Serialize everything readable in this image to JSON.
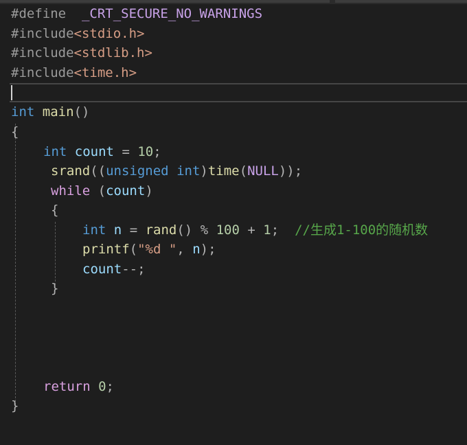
{
  "code": {
    "l1_directive": "#define",
    "l1_macro": "_CRT_SECURE_NO_WARNINGS",
    "l2_directive": "#include",
    "l2_header": "<stdio.h>",
    "l3_directive": "#include",
    "l3_header": "<stdlib.h>",
    "l4_directive": "#include",
    "l4_header": "<time.h>",
    "kw_int": "int",
    "fn_main": "main",
    "parens_empty": "()",
    "brace_open": "{",
    "brace_close": "}",
    "var_count": "count",
    "op_assign": "=",
    "num_10": "10",
    "semicolon": ";",
    "fn_srand": "srand",
    "paren_open2": "((",
    "kw_unsigned": "unsigned",
    "paren_close": ")",
    "fn_time": "time",
    "paren_open": "(",
    "macro_null": "NULL",
    "paren_close2_semi": "));",
    "kw_while": "while",
    "var_n": "n",
    "fn_rand": "rand",
    "op_mod": "%",
    "num_100": "100",
    "op_plus": "+",
    "num_1": "1",
    "comment": "//生成1-100的随机数",
    "fn_printf": "printf",
    "str_fmt": "\"%d \"",
    "comma": ",",
    "paren_close_semi": ");",
    "op_decrement": "--",
    "kw_return": "return",
    "num_0": "0"
  }
}
